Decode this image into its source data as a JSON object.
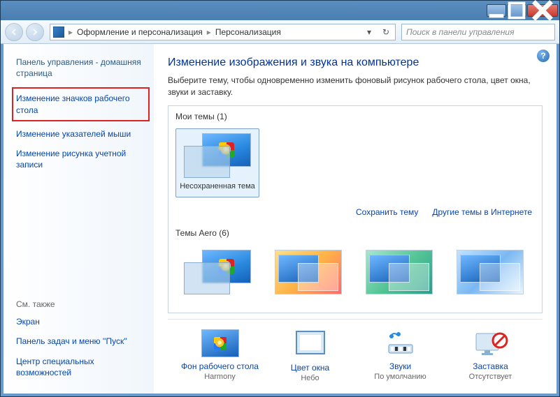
{
  "titlebar": {},
  "nav": {
    "breadcrumb1": "Оформление и персонализация",
    "breadcrumb2": "Персонализация",
    "search_placeholder": "Поиск в панели управления"
  },
  "sidebar": {
    "home": "Панель управления - домашняя страница",
    "links": [
      "Изменение значков рабочего стола",
      "Изменение указателей мыши",
      "Изменение рисунка учетной записи"
    ],
    "see_also_label": "См. также",
    "see_also": [
      "Экран",
      "Панель задач и меню ''Пуск''",
      "Центр специальных возможностей"
    ]
  },
  "main": {
    "heading": "Изменение изображения и звука на компьютере",
    "desc": "Выберите тему, чтобы одновременно изменить фоновый рисунок рабочего стола, цвет окна, звуки и заставку.",
    "my_themes_label": "Мои темы (1)",
    "my_themes": [
      {
        "label": "Несохраненная тема"
      }
    ],
    "save_theme": "Сохранить тему",
    "more_online": "Другие темы в Интернете",
    "aero_label": "Темы Aero (6)",
    "settings": {
      "bg": {
        "title": "Фон рабочего стола",
        "value": "Harmony"
      },
      "color": {
        "title": "Цвет окна",
        "value": "Небо"
      },
      "sound": {
        "title": "Звуки",
        "value": "По умолчанию"
      },
      "saver": {
        "title": "Заставка",
        "value": "Отсутствует"
      }
    }
  }
}
